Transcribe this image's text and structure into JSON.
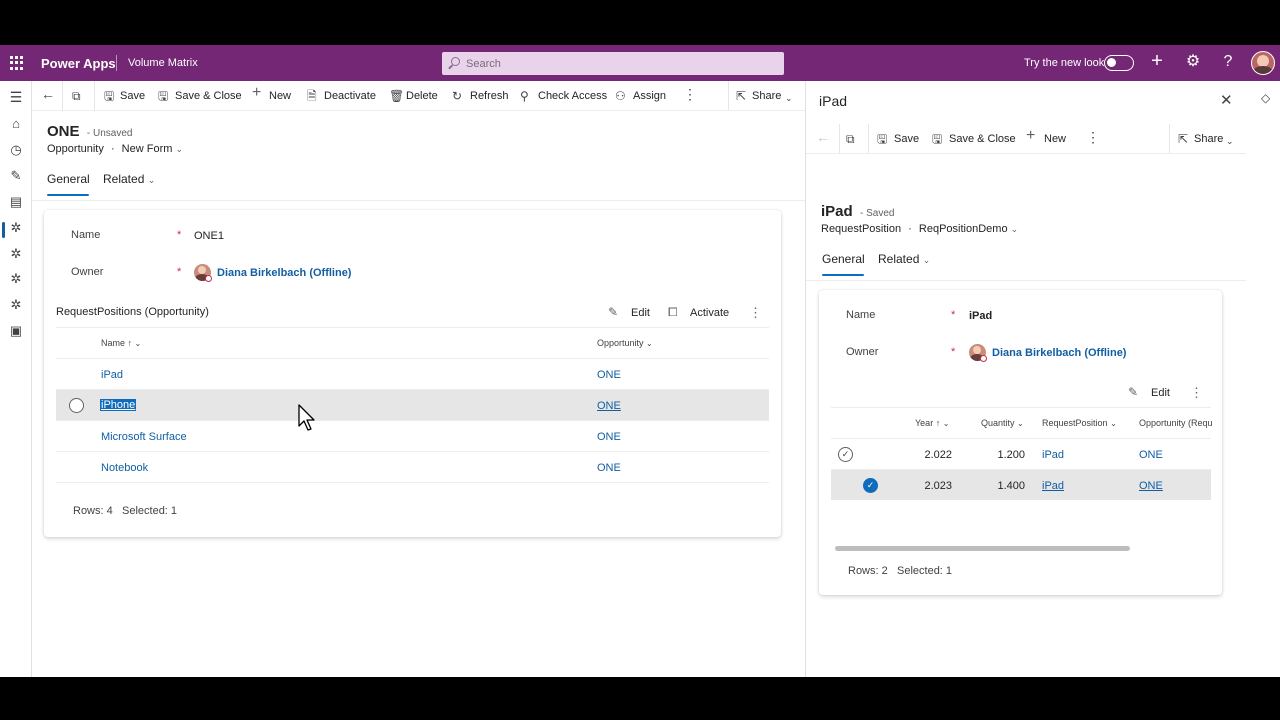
{
  "topbar": {
    "app_name": "Power Apps",
    "environment": "Volume Matrix",
    "search_placeholder": "Search",
    "try_new_look": "Try the new look",
    "toggle_state": "off"
  },
  "main": {
    "commands": {
      "save": "Save",
      "save_close": "Save & Close",
      "new": "New",
      "deactivate": "Deactivate",
      "delete": "Delete",
      "refresh": "Refresh",
      "check_access": "Check Access",
      "assign": "Assign",
      "share": "Share"
    },
    "record": {
      "title": "ONE",
      "status": "- Unsaved",
      "entity": "Opportunity",
      "dot": "·",
      "form": "New Form"
    },
    "tabs": {
      "general": "General",
      "related": "Related"
    },
    "fields": {
      "name_label": "Name",
      "name_value": "ONE1",
      "owner_label": "Owner",
      "owner_value": "Diana Birkelbach (Offline)",
      "required": "*"
    },
    "subgrid": {
      "title": "RequestPositions (Opportunity)",
      "edit": "Edit",
      "activate": "Activate",
      "col_name": "Name",
      "col_opportunity": "Opportunity",
      "rows": [
        {
          "name": "iPad",
          "opportunity": "ONE",
          "selected": false
        },
        {
          "name": "iPhone",
          "opportunity": "ONE",
          "selected": true
        },
        {
          "name": "Microsoft Surface",
          "opportunity": "ONE",
          "selected": false
        },
        {
          "name": "Notebook",
          "opportunity": "ONE",
          "selected": false
        }
      ],
      "rows_count": "Rows: 4",
      "selected_count": "Selected: 1"
    }
  },
  "panel": {
    "header_title": "iPad",
    "commands": {
      "save": "Save",
      "save_close": "Save & Close",
      "new": "New",
      "share": "Share"
    },
    "record": {
      "title": "iPad",
      "status": "- Saved",
      "entity": "RequestPosition",
      "dot": "·",
      "form": "ReqPositionDemo"
    },
    "tabs": {
      "general": "General",
      "related": "Related"
    },
    "fields": {
      "name_label": "Name",
      "name_value": "iPad",
      "owner_label": "Owner",
      "owner_value": "Diana Birkelbach (Offline)",
      "required": "*"
    },
    "subgrid": {
      "edit": "Edit",
      "col_year": "Year",
      "col_quantity": "Quantity",
      "col_requestposition": "RequestPosition",
      "col_opportunity": "Opportunity (Requ",
      "rows": [
        {
          "year": "2.022",
          "quantity": "1.200",
          "requestposition": "iPad",
          "opportunity": "ONE",
          "selected": false
        },
        {
          "year": "2.023",
          "quantity": "1.400",
          "requestposition": "iPad",
          "opportunity": "ONE",
          "selected": true
        }
      ],
      "rows_count": "Rows: 2",
      "selected_count": "Selected: 1"
    }
  },
  "colors": {
    "header": "#742774",
    "accent": "#0f6cbd",
    "link": "#115ea3",
    "selected_row": "#e6e6e6",
    "required": "#c4314b"
  },
  "icons": [
    "waffle-icon",
    "search-icon",
    "plus-icon",
    "gear-icon",
    "help-icon",
    "back-icon",
    "popout-icon",
    "save-icon",
    "save-close-icon",
    "add-icon",
    "deactivate-icon",
    "delete-icon",
    "refresh-icon",
    "check-access-icon",
    "assign-icon",
    "more-icon",
    "share-icon",
    "chevron-down-icon",
    "close-icon",
    "edit-icon",
    "activate-icon",
    "sort-up-icon",
    "checkmark-icon"
  ]
}
